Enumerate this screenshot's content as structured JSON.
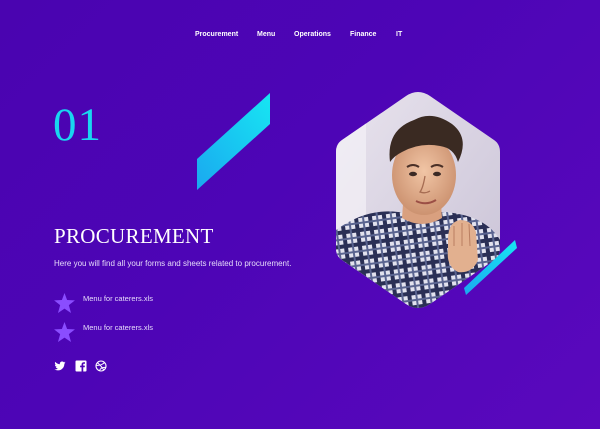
{
  "nav": {
    "items": [
      {
        "label": "Procurement"
      },
      {
        "label": "Menu"
      },
      {
        "label": "Operations"
      },
      {
        "label": "Finance"
      },
      {
        "label": "IT"
      }
    ]
  },
  "hero": {
    "number": "01",
    "title": "PROCUREMENT",
    "description": "Here you will find all your forms and sheets related to procurement."
  },
  "files": [
    {
      "label": "Menu for caterers.xls",
      "icon": "star-icon"
    },
    {
      "label": "Menu for caterers.xls",
      "icon": "star-icon"
    }
  ],
  "social": [
    {
      "icon": "twitter-icon"
    },
    {
      "icon": "facebook-icon"
    },
    {
      "icon": "dribbble-icon"
    }
  ],
  "colors": {
    "background": "#4d05b6",
    "accent": "#19d6f0",
    "star": "#8a4dff",
    "text": "#ffffff"
  }
}
